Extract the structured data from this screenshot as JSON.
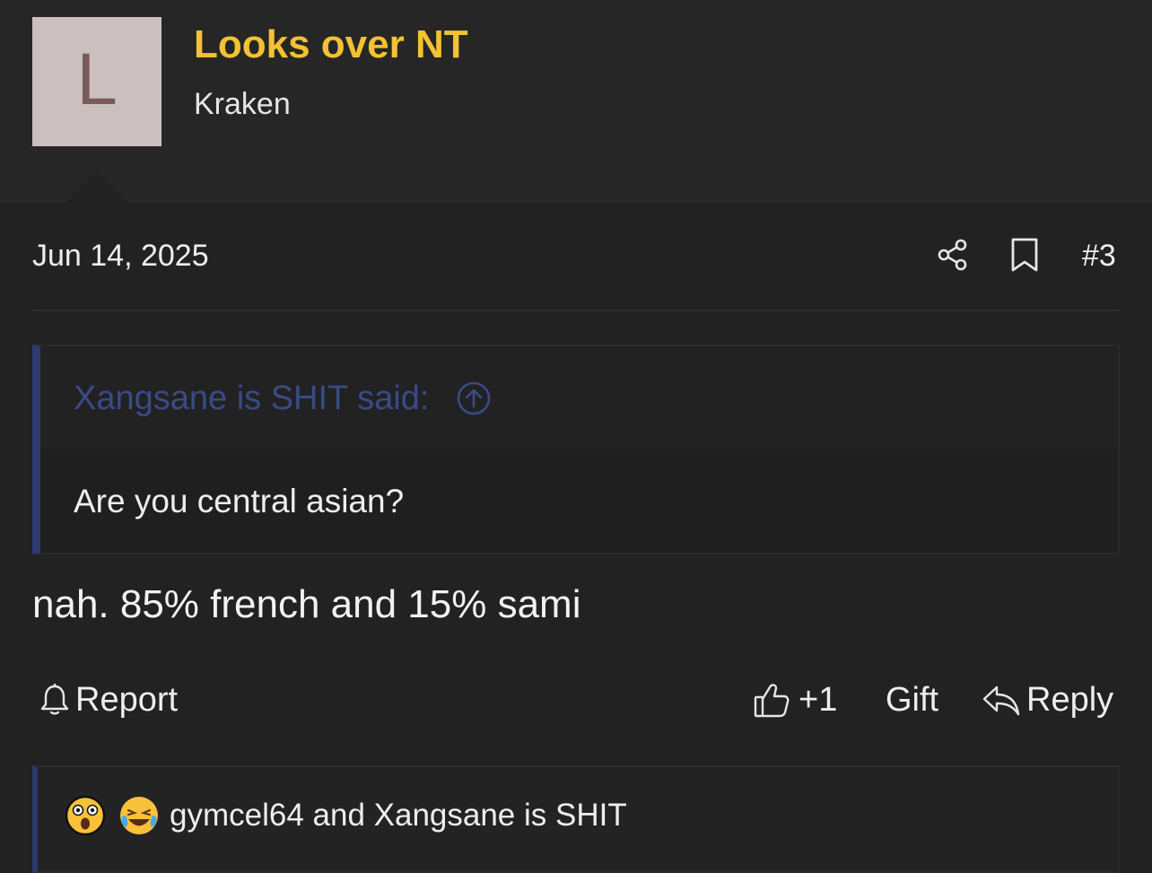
{
  "author": {
    "avatar_letter": "L",
    "name": "Looks over NT",
    "title": "Kraken"
  },
  "post": {
    "date": "Jun 14, 2025",
    "number": "#3",
    "message": "nah. 85% french and 15% sami"
  },
  "quote": {
    "author_label": "Xangsane is SHIT said:",
    "text": "Are you central asian?"
  },
  "actions": {
    "report": "Report",
    "like_count": "+1",
    "gift": "Gift",
    "reply": "Reply"
  },
  "reactions": {
    "emojis": [
      "astonished-face",
      "crying-laughing-face"
    ],
    "names": "gymcel64 and Xangsane is SHIT"
  },
  "colors": {
    "background": "#222222",
    "username": "#f2c234",
    "quote_accent": "#2c3a6e",
    "quote_author": "#3a4a87"
  }
}
